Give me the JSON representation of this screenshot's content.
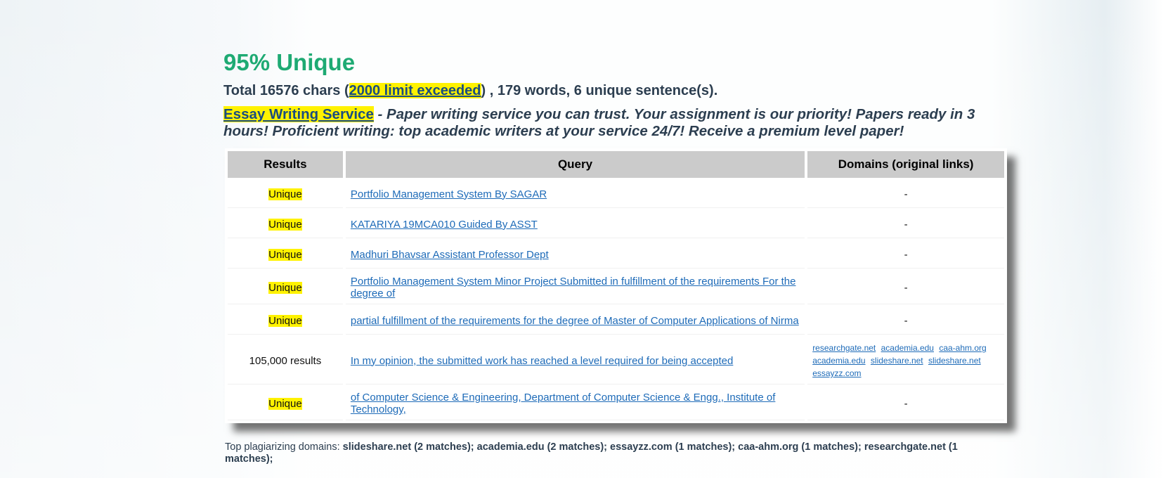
{
  "heading": "95% Unique",
  "total": {
    "prefix": "Total 16576 chars (",
    "limit_link": "2000 limit exceeded",
    "suffix": ") , 179 words, 6 unique sentence(s)."
  },
  "promo": {
    "link": "Essay Writing Service",
    "text": " - Paper writing service you can trust. Your assignment is our priority! Papers ready in 3 hours! Proficient writing: top academic writers at your service 24/7! Receive a premium level paper!"
  },
  "table": {
    "headers": [
      "Results",
      "Query",
      "Domains (original links)"
    ],
    "rows": [
      {
        "result": "Unique",
        "query": "Portfolio Management System By SAGAR",
        "domains": "-"
      },
      {
        "result": "Unique",
        "query": "KATARIYA 19MCA010 Guided By ASST",
        "domains": "-"
      },
      {
        "result": "Unique",
        "query": "Madhuri Bhavsar Assistant Professor Dept",
        "domains": "-"
      },
      {
        "result": "Unique",
        "query": "Portfolio Management System Minor Project Submitted in fulfillment of the requirements For the degree of",
        "domains": "-"
      },
      {
        "result": "Unique",
        "query": "partial fulfillment of the requirements for the degree of Master of Computer Applications of Nirma",
        "domains": "-"
      },
      {
        "result": "105,000 results",
        "query": "In my opinion, the submitted work has reached a level required for being accepted",
        "domain_links": [
          "researchgate.net",
          "academia.edu",
          "caa-ahm.org",
          "academia.edu",
          "slideshare.net",
          "slideshare.net",
          "essayzz.com"
        ]
      },
      {
        "result": "Unique",
        "query": "of Computer Science & Engineering, Department of Computer Science & Engg., Institute of Technology,",
        "domains": "-"
      }
    ]
  },
  "top_domains": {
    "label": "Top plagiarizing domains: ",
    "items": "slideshare.net (2 matches); academia.edu (2 matches); essayzz.com (1 matches); caa-ahm.org (1 matches); researchgate.net (1 matches);"
  },
  "colors": {
    "unique_heading": "#1eaa73",
    "highlight": "#fff200",
    "link": "#1e6bb8",
    "header_bg": "#cbcbcb"
  }
}
